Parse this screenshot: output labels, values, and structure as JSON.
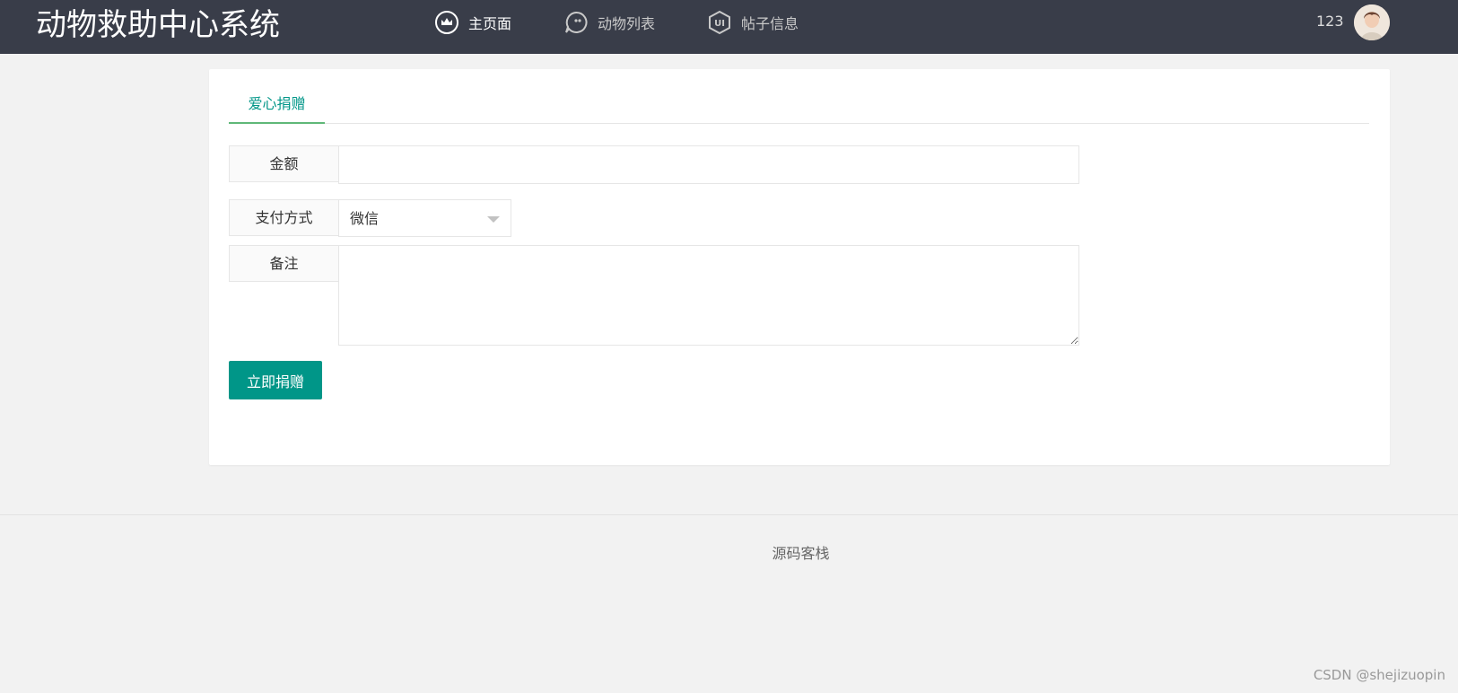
{
  "header": {
    "logo": "动物救助中心系统",
    "nav": [
      {
        "label": "主页面",
        "icon": "crown-icon",
        "active": true
      },
      {
        "label": "动物列表",
        "icon": "chat-bubble-icon",
        "active": false
      },
      {
        "label": "帖子信息",
        "icon": "ui-shield-icon",
        "active": false
      }
    ],
    "user_name": "123"
  },
  "tabs": [
    {
      "label": "爱心捐赠",
      "active": true
    }
  ],
  "form": {
    "amount_label": "金额",
    "amount_value": "",
    "payment_label": "支付方式",
    "payment_selected": "微信",
    "remark_label": "备注",
    "remark_value": "",
    "submit_label": "立即捐赠"
  },
  "footer": {
    "text": "源码客栈"
  },
  "watermark": "CSDN @shejizuopin",
  "colors": {
    "header_bg": "#393d49",
    "primary": "#009688",
    "tab_underline": "#5fb878",
    "page_bg": "#f2f2f2"
  }
}
